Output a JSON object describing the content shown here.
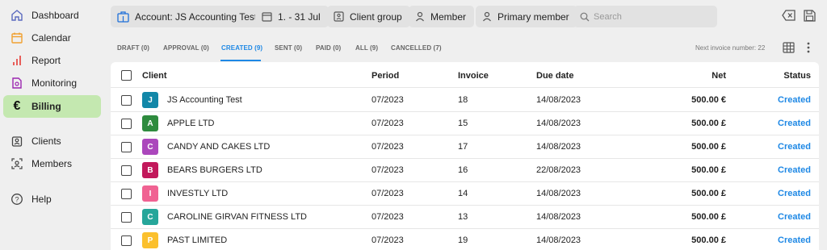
{
  "sidebar": {
    "items": [
      {
        "label": "Dashboard",
        "icon": "home-icon"
      },
      {
        "label": "Calendar",
        "icon": "calendar-icon"
      },
      {
        "label": "Report",
        "icon": "bar-chart-icon"
      },
      {
        "label": "Monitoring",
        "icon": "monitoring-icon"
      },
      {
        "label": "Billing",
        "icon": "euro-icon",
        "active": true
      },
      {
        "label": "Clients",
        "icon": "clients-icon"
      },
      {
        "label": "Members",
        "icon": "members-icon"
      },
      {
        "label": "Help",
        "icon": "help-icon"
      }
    ]
  },
  "filters": {
    "account": "Account: JS Accounting Test",
    "date_range": "1. - 31 Jul",
    "client_group": "Client group",
    "member": "Member",
    "primary_member": "Primary member",
    "search_placeholder": "Search"
  },
  "tabs": [
    {
      "label": "DRAFT (0)"
    },
    {
      "label": "APPROVAL (0)"
    },
    {
      "label": "CREATED (9)",
      "active": true
    },
    {
      "label": "SENT (0)"
    },
    {
      "label": "PAID (0)"
    },
    {
      "label": "ALL (9)"
    },
    {
      "label": "CANCELLED (7)"
    }
  ],
  "next_invoice": "Next invoice number: 22",
  "table": {
    "headers": {
      "client": "Client",
      "period": "Period",
      "invoice": "Invoice",
      "due_date": "Due date",
      "net": "Net",
      "status": "Status"
    },
    "rows": [
      {
        "initial": "J",
        "color": "#1287a8",
        "client": "JS Accounting Test",
        "period": "07/2023",
        "invoice": "18",
        "due": "14/08/2023",
        "net": "500.00 €",
        "status": "Created"
      },
      {
        "initial": "A",
        "color": "#2e8b3e",
        "client": "APPLE LTD",
        "period": "07/2023",
        "invoice": "15",
        "due": "14/08/2023",
        "net": "500.00 £",
        "status": "Created"
      },
      {
        "initial": "C",
        "color": "#ab47bc",
        "client": "CANDY AND CAKES LTD",
        "period": "07/2023",
        "invoice": "17",
        "due": "14/08/2023",
        "net": "500.00 £",
        "status": "Created"
      },
      {
        "initial": "B",
        "color": "#c2185b",
        "client": "BEARS BURGERS LTD",
        "period": "07/2023",
        "invoice": "16",
        "due": "22/08/2023",
        "net": "500.00 £",
        "status": "Created"
      },
      {
        "initial": "I",
        "color": "#f06292",
        "client": "INVESTLY LTD",
        "period": "07/2023",
        "invoice": "14",
        "due": "14/08/2023",
        "net": "500.00 £",
        "status": "Created"
      },
      {
        "initial": "C",
        "color": "#26a69a",
        "client": "CAROLINE GIRVAN FITNESS LTD",
        "period": "07/2023",
        "invoice": "13",
        "due": "14/08/2023",
        "net": "500.00 £",
        "status": "Created"
      },
      {
        "initial": "P",
        "color": "#fbc02d",
        "client": "PAST LIMITED",
        "period": "07/2023",
        "invoice": "19",
        "due": "14/08/2023",
        "net": "500.00 £",
        "status": "Created"
      }
    ]
  },
  "colors": {
    "accent": "#1e88e5",
    "active_nav": "#c4e8b0"
  }
}
